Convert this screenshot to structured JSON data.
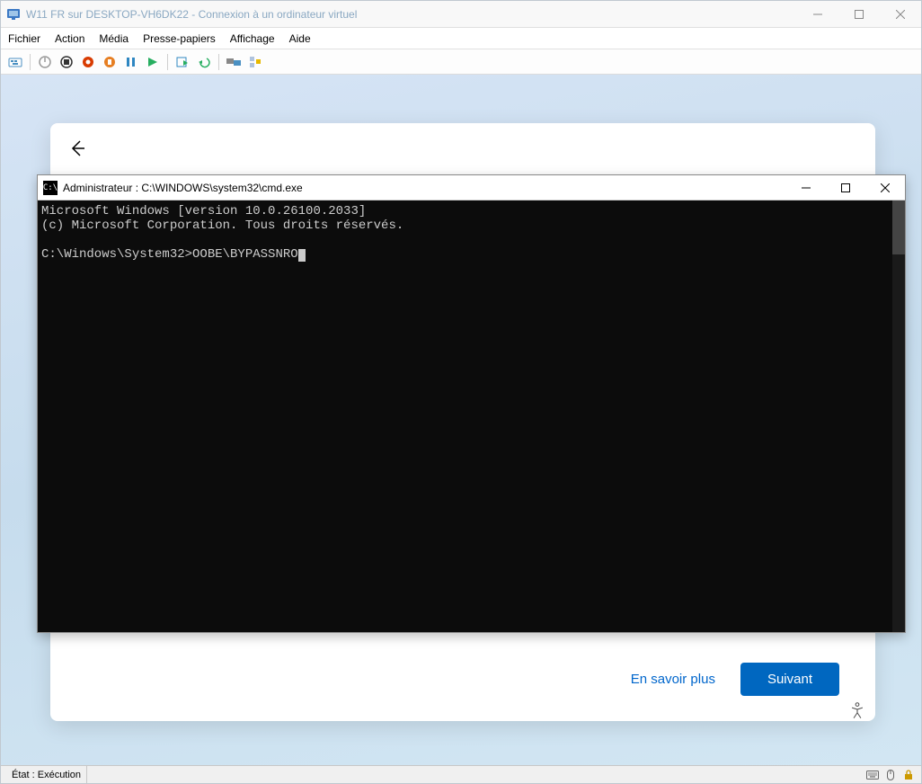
{
  "window": {
    "title": "W11 FR sur DESKTOP-VH6DK22 - Connexion à un ordinateur virtuel"
  },
  "menu": {
    "file": "Fichier",
    "action": "Action",
    "media": "Média",
    "clipboard": "Presse-papiers",
    "view": "Affichage",
    "help": "Aide"
  },
  "oobe": {
    "learn_more": "En savoir plus",
    "next": "Suivant"
  },
  "cmd": {
    "title": "Administrateur : C:\\WINDOWS\\system32\\cmd.exe",
    "line1": "Microsoft Windows [version 10.0.26100.2033]",
    "line2": "(c) Microsoft Corporation. Tous droits réservés.",
    "prompt": "C:\\Windows\\System32>OOBE\\BYPASSNRO"
  },
  "status": {
    "label": "État : Exécution"
  }
}
